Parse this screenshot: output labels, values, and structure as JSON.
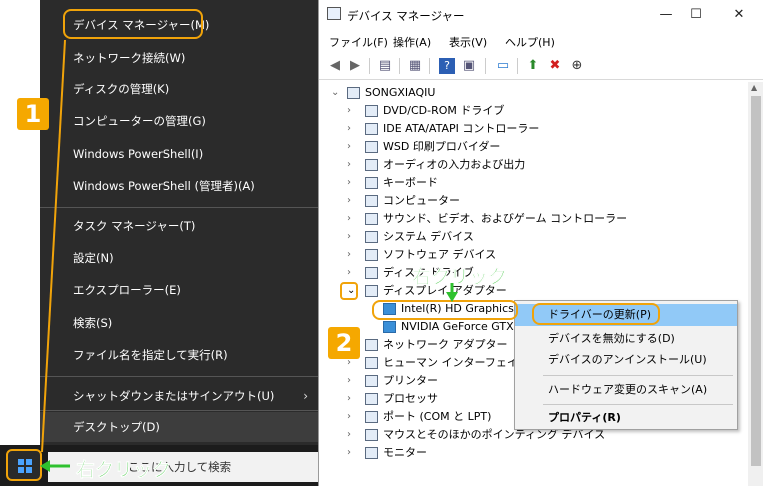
{
  "winx_menu": {
    "items": [
      {
        "label": "デバイス マネージャー(M)"
      },
      {
        "label": "ネットワーク接続(W)"
      },
      {
        "label": "ディスクの管理(K)"
      },
      {
        "label": "コンピューターの管理(G)"
      },
      {
        "label": "Windows PowerShell(I)"
      },
      {
        "label": "Windows PowerShell (管理者)(A)"
      },
      {
        "label": "タスク マネージャー(T)"
      },
      {
        "label": "設定(N)"
      },
      {
        "label": "エクスプローラー(E)"
      },
      {
        "label": "検索(S)"
      },
      {
        "label": "ファイル名を指定して実行(R)"
      },
      {
        "label": "シャットダウンまたはサインアウト(U)",
        "arrow": "›"
      },
      {
        "label": "デスクトップ(D)"
      }
    ]
  },
  "taskbar": {
    "search_text": "ここに入力して検索"
  },
  "annotations": {
    "badge1": "1",
    "badge2": "2",
    "right_click_1": "右クリック",
    "right_click_2": "右クリック"
  },
  "device_manager": {
    "title": "デバイス マネージャー",
    "window_buttons": {
      "minimize": "—",
      "maximize": "☐",
      "close": "✕"
    },
    "menu": [
      "ファイル(F)",
      "操作(A)",
      "表示(V)",
      "ヘルプ(H)"
    ],
    "tree": {
      "root": "SONGXIAQIU",
      "categories": [
        "DVD/CD-ROM ドライブ",
        "IDE ATA/ATAPI コントローラー",
        "WSD 印刷プロバイダー",
        "オーディオの入力および出力",
        "キーボード",
        "コンピューター",
        "サウンド、ビデオ、およびゲーム コントローラー",
        "システム デバイス",
        "ソフトウェア デバイス",
        "ディスク ドライブ",
        "ディスプレイ アダプター"
      ],
      "display_children": [
        "Intel(R) HD Graphics",
        "NVIDIA GeForce GTX"
      ],
      "after": [
        "ネットワーク アダプター",
        "ヒューマン インターフェイス デバイス",
        "プリンター",
        "プロセッサ",
        "ポート (COM と LPT)",
        "マウスとそのほかのポインティング デバイス",
        "モニター"
      ]
    },
    "context_menu": [
      "ドライバーの更新(P)",
      "デバイスを無効にする(D)",
      "デバイスのアンインストール(U)",
      "ハードウェア変更のスキャン(A)",
      "プロパティ(R)"
    ]
  },
  "colors": {
    "accent_orange": "#f0a30a",
    "highlight_green": "#2fc12f",
    "menu_bg": "#2b2b2b",
    "ctx_selected": "#91c9f7"
  }
}
